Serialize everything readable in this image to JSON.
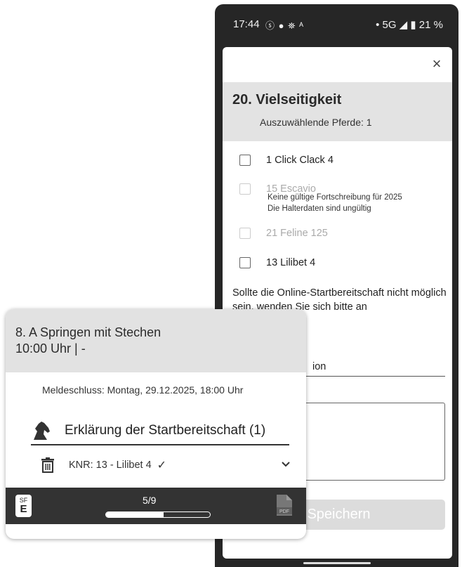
{
  "status_bar": {
    "time": "17:44",
    "left_icons": "ⓢ ● ⛯ ᴬ",
    "right": "•  5G ◢ ▮ 21 %"
  },
  "dialog": {
    "close_label": "×",
    "title": "20. Vielseitigkeit",
    "subtitle": "Auszuwählende Pferde: 1",
    "horses": [
      {
        "label": "1 Click Clack 4",
        "disabled": false
      },
      {
        "label": "15 Escavio",
        "disabled": true
      },
      {
        "label": "21 Feline 125",
        "disabled": true
      },
      {
        "label": "13 Lilibet 4",
        "disabled": false
      }
    ],
    "warnings": [
      "Keine gültige Fortschreibung für 2025",
      "Die Halterdaten sind ungültig"
    ],
    "info_text": "Sollte die Online-Startbereitschaft nicht möglich sein, wenden Sie sich bitte an",
    "field_fragment": "ion",
    "save_label": "Speichern"
  },
  "card": {
    "title": "8. A Springen mit Stechen",
    "time": "10:00 Uhr | -",
    "deadline": "Meldeschluss:  Montag, 29.12.2025, 18:00 Uhr",
    "declaration_label": "Erklärung der Startbereitschaft (1)",
    "entry": "KNR: 13 - Lilibet 4",
    "entry_check": "✓",
    "badge_top": "SF",
    "badge_bottom": "E",
    "progress_label": "5/9",
    "progress_fraction": 0.5556
  },
  "icons": {
    "horse": "horse-head-icon",
    "trash": "trash-icon",
    "expand": "chevron-down-icon",
    "pdf": "pdf-icon",
    "close": "close-icon"
  }
}
